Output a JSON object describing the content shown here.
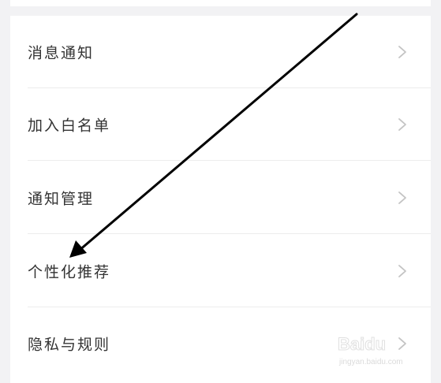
{
  "menu": {
    "items": [
      {
        "label": "消息通知"
      },
      {
        "label": "加入白名单"
      },
      {
        "label": "通知管理"
      },
      {
        "label": "个性化推荐"
      },
      {
        "label": "隐私与规则"
      }
    ]
  },
  "watermark": {
    "brand": "Baidu",
    "sub": "jingyan.baidu.com"
  },
  "colors": {
    "background": "#f2f2f4",
    "card": "#ffffff",
    "text": "#333333",
    "divider": "#ececec",
    "chevron": "#c4c4c4",
    "annotation_arrow": "#000000"
  },
  "icons": {
    "row_chevron": "chevron-right-icon",
    "annotation": "annotation-arrow-icon"
  }
}
